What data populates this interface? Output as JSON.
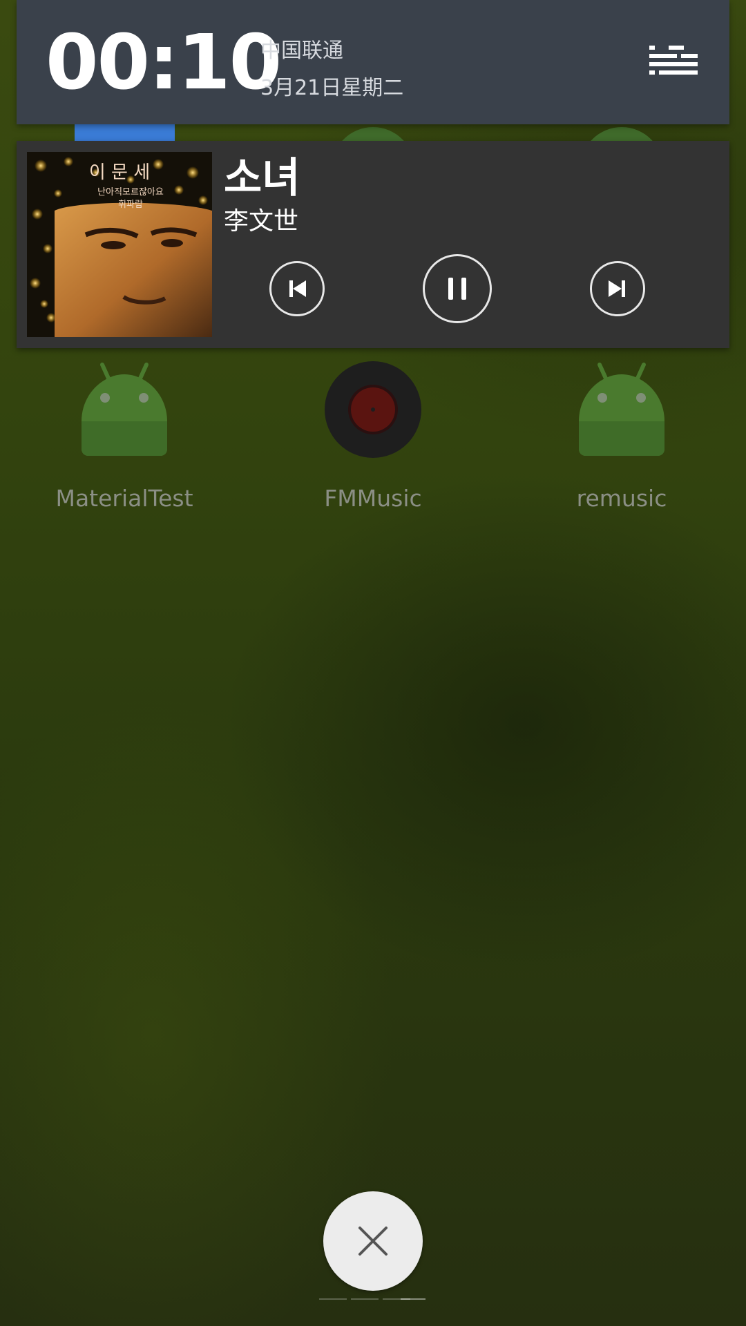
{
  "header": {
    "time": "00:10",
    "carrier": "中国联通",
    "date": "3月21日星期二",
    "menu_icon": "list-menu-icon"
  },
  "media": {
    "title": "소녀",
    "artist": "李文世",
    "album_art": {
      "headline": "이 문 세",
      "line1": "난아직모르잖아요",
      "line2": "휘파람"
    },
    "controls": {
      "previous_icon": "skip-previous-icon",
      "pause_icon": "pause-icon",
      "next_icon": "skip-next-icon"
    }
  },
  "apps": [
    {
      "label": "MaterialTest",
      "icon": "android-robot-icon"
    },
    {
      "label": "FMMusic",
      "icon": "vinyl-record-icon"
    },
    {
      "label": "remusic",
      "icon": "android-robot-icon"
    }
  ],
  "close_button": {
    "icon": "close-icon"
  },
  "colors": {
    "header_bg": "#3a414b",
    "card_bg": "#333333",
    "wallpaper": "#2e3a10",
    "label_gray": "#8b8f85"
  }
}
